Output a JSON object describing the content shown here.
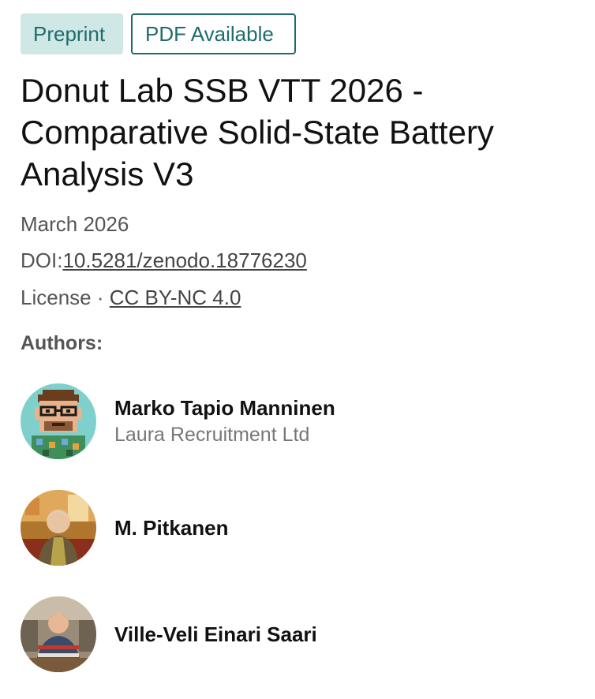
{
  "badges": {
    "preprint": "Preprint",
    "pdf": "PDF Available"
  },
  "title": "Donut Lab SSB VTT 2026 - Comparative Solid-State Battery Analysis V3",
  "meta": {
    "date": "March 2026",
    "doi_label": "DOI:",
    "doi_value": "10.5281/zenodo.18776230",
    "license_label": "License",
    "license_separator": "·",
    "license_value": "CC BY-NC 4.0"
  },
  "authors_heading": "Authors:",
  "authors": [
    {
      "name": "Marko Tapio Manninen",
      "affiliation": "Laura Recruitment Ltd",
      "avatar_icon": "pixel-art-portrait"
    },
    {
      "name": "M. Pitkanen",
      "affiliation": "",
      "avatar_icon": "photo-portrait"
    },
    {
      "name": "Ville-Veli Einari Saari",
      "affiliation": "",
      "avatar_icon": "photo-portrait"
    }
  ],
  "colors": {
    "accent": "#1f6b6c",
    "badge_fill": "#cfe8e6",
    "muted_text": "#555555"
  }
}
